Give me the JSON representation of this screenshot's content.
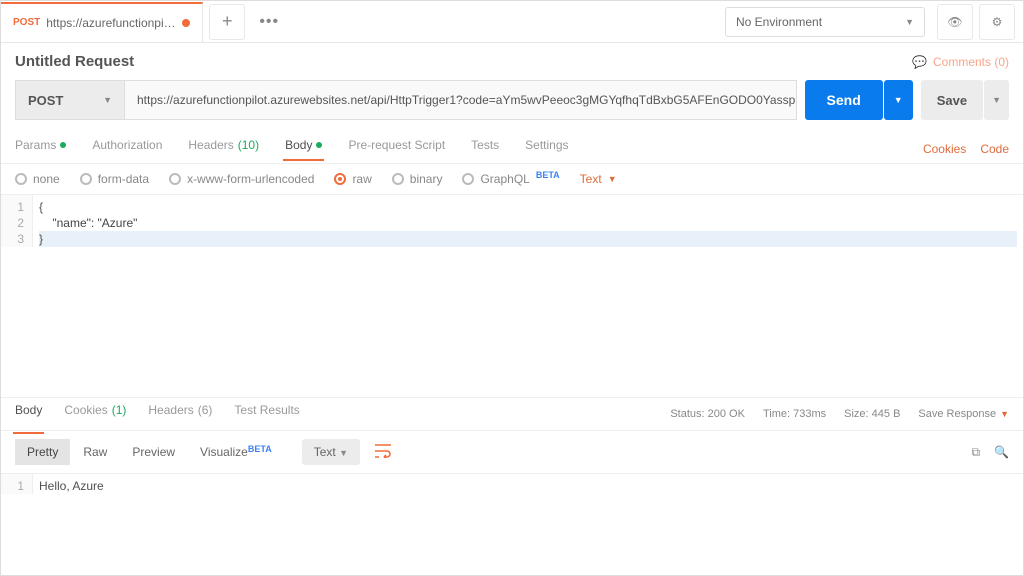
{
  "topbar": {
    "tab_method": "POST",
    "tab_title": "https://azurefunctionpilot.azu...",
    "environment": "No Environment"
  },
  "request": {
    "title": "Untitled Request",
    "comments_label": "Comments (0)",
    "method": "POST",
    "url": "https://azurefunctionpilot.azurewebsites.net/api/HttpTrigger1?code=aYm5wvPeeoc3gMGYqfhqTdBxbG5AFEnGODO0Yassp...",
    "send_label": "Send",
    "save_label": "Save"
  },
  "tabs": {
    "params": "Params",
    "authorization": "Authorization",
    "headers": "Headers",
    "headers_count": "(10)",
    "body": "Body",
    "prerequest": "Pre-request Script",
    "tests": "Tests",
    "settings": "Settings",
    "cookies_link": "Cookies",
    "code_link": "Code"
  },
  "body_options": {
    "none": "none",
    "form_data": "form-data",
    "x_www": "x-www-form-urlencoded",
    "raw": "raw",
    "binary": "binary",
    "graphql": "GraphQL",
    "beta": "BETA",
    "text_sel": "Text"
  },
  "editor_lines": [
    "{",
    "    \"name\": \"Azure\"",
    "}"
  ],
  "response": {
    "tabs": {
      "body": "Body",
      "cookies": "Cookies",
      "cookies_count": "(1)",
      "headers": "Headers",
      "headers_count": "(6)",
      "test_results": "Test Results"
    },
    "status_label": "Status:",
    "status_value": "200 OK",
    "time_label": "Time:",
    "time_value": "733ms",
    "size_label": "Size:",
    "size_value": "445 B",
    "save_response": "Save Response",
    "view": {
      "pretty": "Pretty",
      "raw": "Raw",
      "preview": "Preview",
      "visualize": "Visualize",
      "beta": "BETA",
      "format": "Text"
    },
    "body_lines": [
      "Hello, Azure"
    ]
  }
}
